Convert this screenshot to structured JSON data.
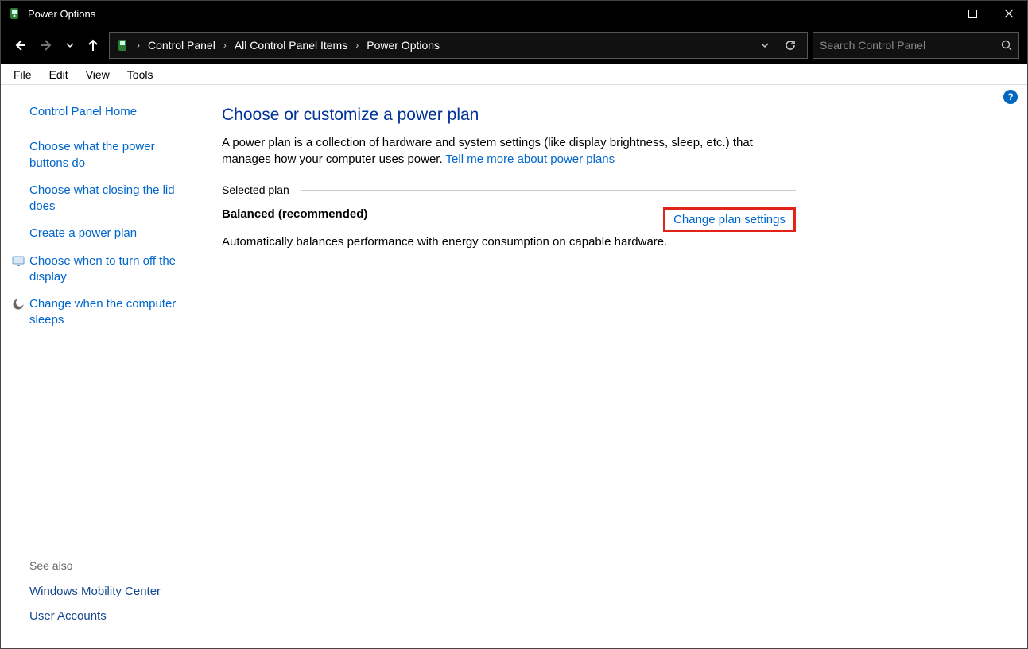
{
  "window": {
    "title": "Power Options"
  },
  "breadcrumb": {
    "items": [
      "Control Panel",
      "All Control Panel Items",
      "Power Options"
    ]
  },
  "search": {
    "placeholder": "Search Control Panel"
  },
  "menu": {
    "items": [
      "File",
      "Edit",
      "View",
      "Tools"
    ]
  },
  "sidebar": {
    "home": "Control Panel Home",
    "links": [
      {
        "label": "Choose what the power buttons do",
        "icon": null
      },
      {
        "label": "Choose what closing the lid does",
        "icon": null
      },
      {
        "label": "Create a power plan",
        "icon": null
      },
      {
        "label": "Choose when to turn off the display",
        "icon": "monitor"
      },
      {
        "label": "Change when the computer sleeps",
        "icon": "moon"
      }
    ],
    "see_also_label": "See also",
    "see_also": [
      "Windows Mobility Center",
      "User Accounts"
    ]
  },
  "main": {
    "heading": "Choose or customize a power plan",
    "description_pre": "A power plan is a collection of hardware and system settings (like display brightness, sleep, etc.) that manages how your computer uses power. ",
    "description_link": "Tell me more about power plans",
    "section_label": "Selected plan",
    "plan": {
      "name": "Balanced (recommended)",
      "desc": "Automatically balances performance with energy consumption on capable hardware.",
      "change_label": "Change plan settings"
    }
  },
  "help_glyph": "?"
}
